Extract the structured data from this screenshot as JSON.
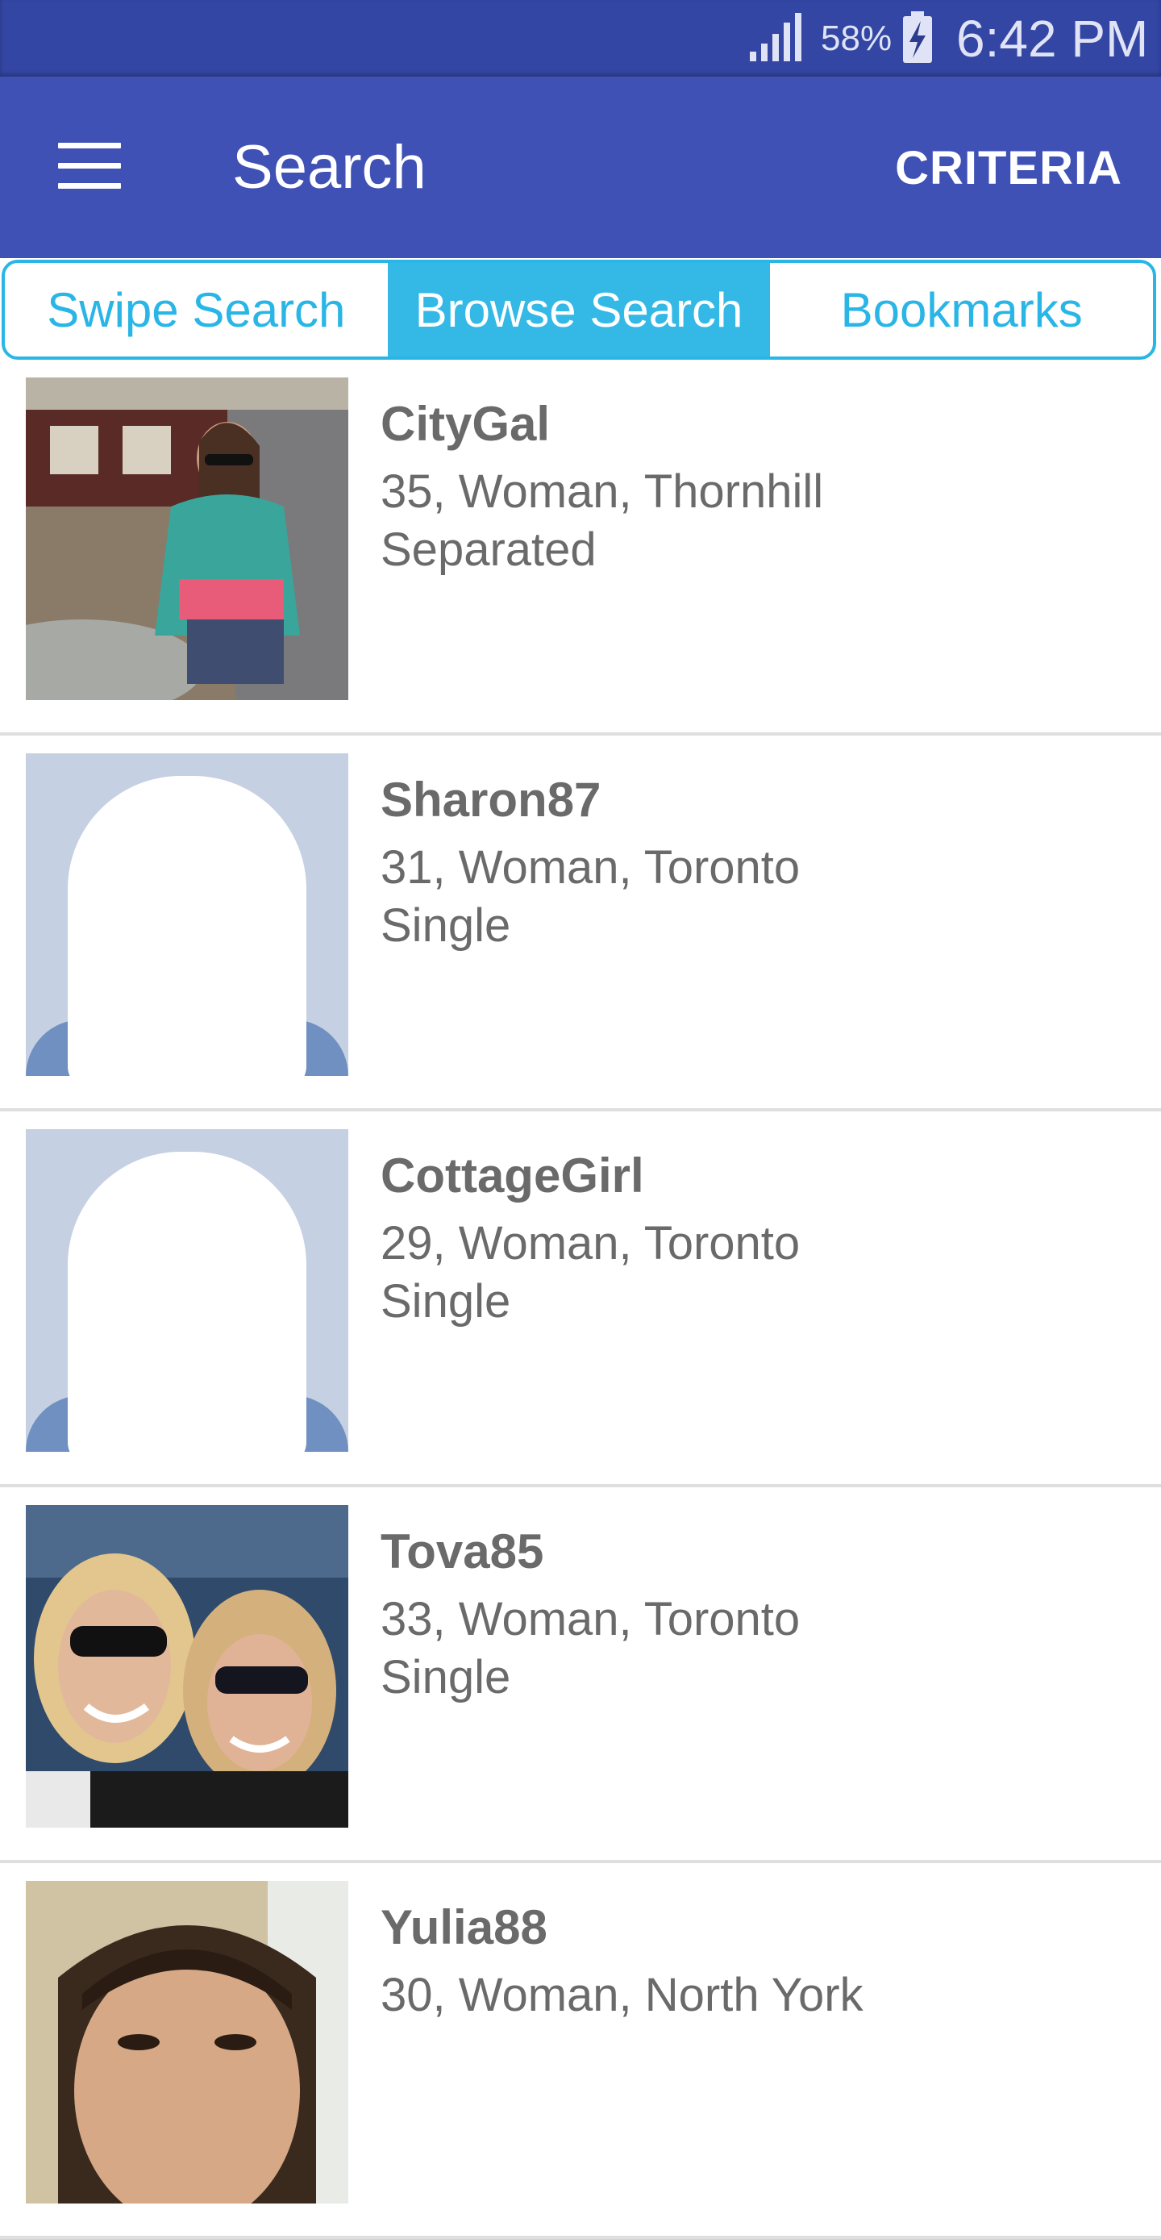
{
  "status_bar": {
    "battery_percent": "58%",
    "time": "6:42 PM"
  },
  "app_bar": {
    "title": "Search",
    "action": "CRITERIA"
  },
  "tabs": [
    {
      "label": "Swipe Search",
      "active": false
    },
    {
      "label": "Browse Search",
      "active": true
    },
    {
      "label": "Bookmarks",
      "active": false
    }
  ],
  "results": [
    {
      "name": "CityGal",
      "details": "35, Woman, Thornhill",
      "status": "Separated",
      "photo": "outdoor-patio-photo"
    },
    {
      "name": "Sharon87",
      "details": "31, Woman, Toronto",
      "status": "Single",
      "photo": "default-female-avatar"
    },
    {
      "name": "CottageGirl",
      "details": "29, Woman, Toronto",
      "status": "Single",
      "photo": "default-female-avatar"
    },
    {
      "name": "Tova85",
      "details": "33, Woman, Toronto",
      "status": "Single",
      "photo": "two-women-sunglasses-photo"
    },
    {
      "name": "Yulia88",
      "details": "30, Woman, North York",
      "status": "",
      "photo": "selfie-photo"
    }
  ],
  "colors": {
    "status_bar": "#3346a3",
    "app_bar": "#3f51b5",
    "tab_accent": "#29b6e6",
    "text_secondary": "#6a6a6a"
  }
}
